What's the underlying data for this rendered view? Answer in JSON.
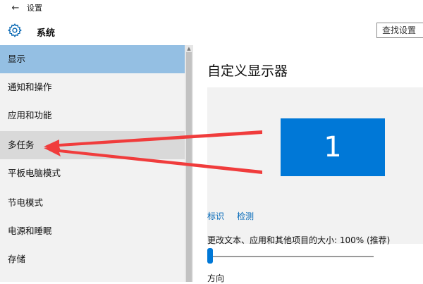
{
  "window": {
    "back_icon": "arrow-left-icon",
    "title": "设置"
  },
  "header": {
    "icon": "gear-icon",
    "section": "系统",
    "search_placeholder": "查找设置"
  },
  "sidebar": {
    "items": [
      {
        "label": "显示",
        "state": "selected"
      },
      {
        "label": "通知和操作",
        "state": "normal"
      },
      {
        "label": "应用和功能",
        "state": "normal"
      },
      {
        "label": "多任务",
        "state": "hover"
      },
      {
        "label": "平板电脑模式",
        "state": "normal"
      },
      {
        "label": "节电模式",
        "state": "normal"
      },
      {
        "label": "电源和睡眠",
        "state": "normal"
      },
      {
        "label": "存储",
        "state": "normal"
      }
    ]
  },
  "content": {
    "title": "自定义显示器",
    "monitor_number": "1",
    "links": {
      "identify": "标识",
      "detect": "检测"
    },
    "scale_label": "更改文本、应用和其他项目的大小: 100% (推荐)",
    "scale_slider_value": 0,
    "orientation_label": "方向"
  },
  "colors": {
    "accent": "#0078d7",
    "selected_nav": "#94bfe3",
    "hover_nav": "#d9d9d9",
    "sidebar_bg": "#f2f2f2",
    "link": "#0067b8",
    "annotation_arrow": "#f03c3c"
  }
}
